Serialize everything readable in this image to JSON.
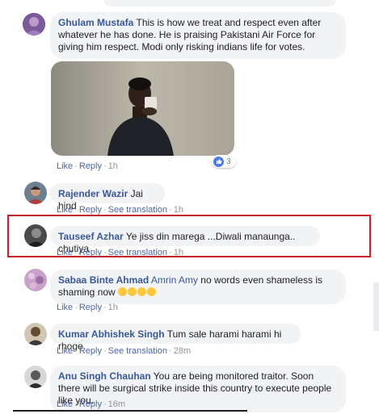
{
  "comments": [
    {
      "author": "Ghulam Mustafa",
      "text": "This is how we treat and respect even after whatever he has done. He is praising Pakistani Air Force for giving him respect. Modi only risking indians life for votes.",
      "actions": {
        "like": "Like",
        "reply": "Reply",
        "time": "1h"
      },
      "reaction_count": "3"
    },
    {
      "author": "Rajender Wazir",
      "text": "Jai hind",
      "actions": {
        "like": "Like",
        "reply": "Reply",
        "translate": "See translation",
        "time": "1h"
      }
    },
    {
      "author": "Tauseef Azhar",
      "text": "Ye jiss din marega ...Diwali manaunga.. chutiya",
      "actions": {
        "like": "Like",
        "reply": "Reply",
        "translate": "See translation",
        "time": "1h"
      }
    },
    {
      "author": "Sabaa Binte Ahmad",
      "tagged": "Amrin Amy",
      "text": "no words even shameless is shaming now",
      "actions": {
        "like": "Like",
        "reply": "Reply",
        "time": "1h"
      }
    },
    {
      "author": "Kumar Abhishek Singh",
      "text": "Tum sale harami harami hi rhoge",
      "actions": {
        "like": "Like",
        "reply": "Reply",
        "translate": "See translation",
        "time": "28m"
      }
    },
    {
      "author": "Anu Singh Chauhan",
      "text": "You are being monitored traitor. Soon there will be surgical strike inside this country to execute people like you.",
      "actions": {
        "like": "Like",
        "reply": "Reply",
        "time": "16m"
      }
    }
  ],
  "colors": {
    "author": "#385898",
    "bubble": "#f2f3f5",
    "highlight": "#c8202a",
    "like_badge": "#4a7be9"
  }
}
